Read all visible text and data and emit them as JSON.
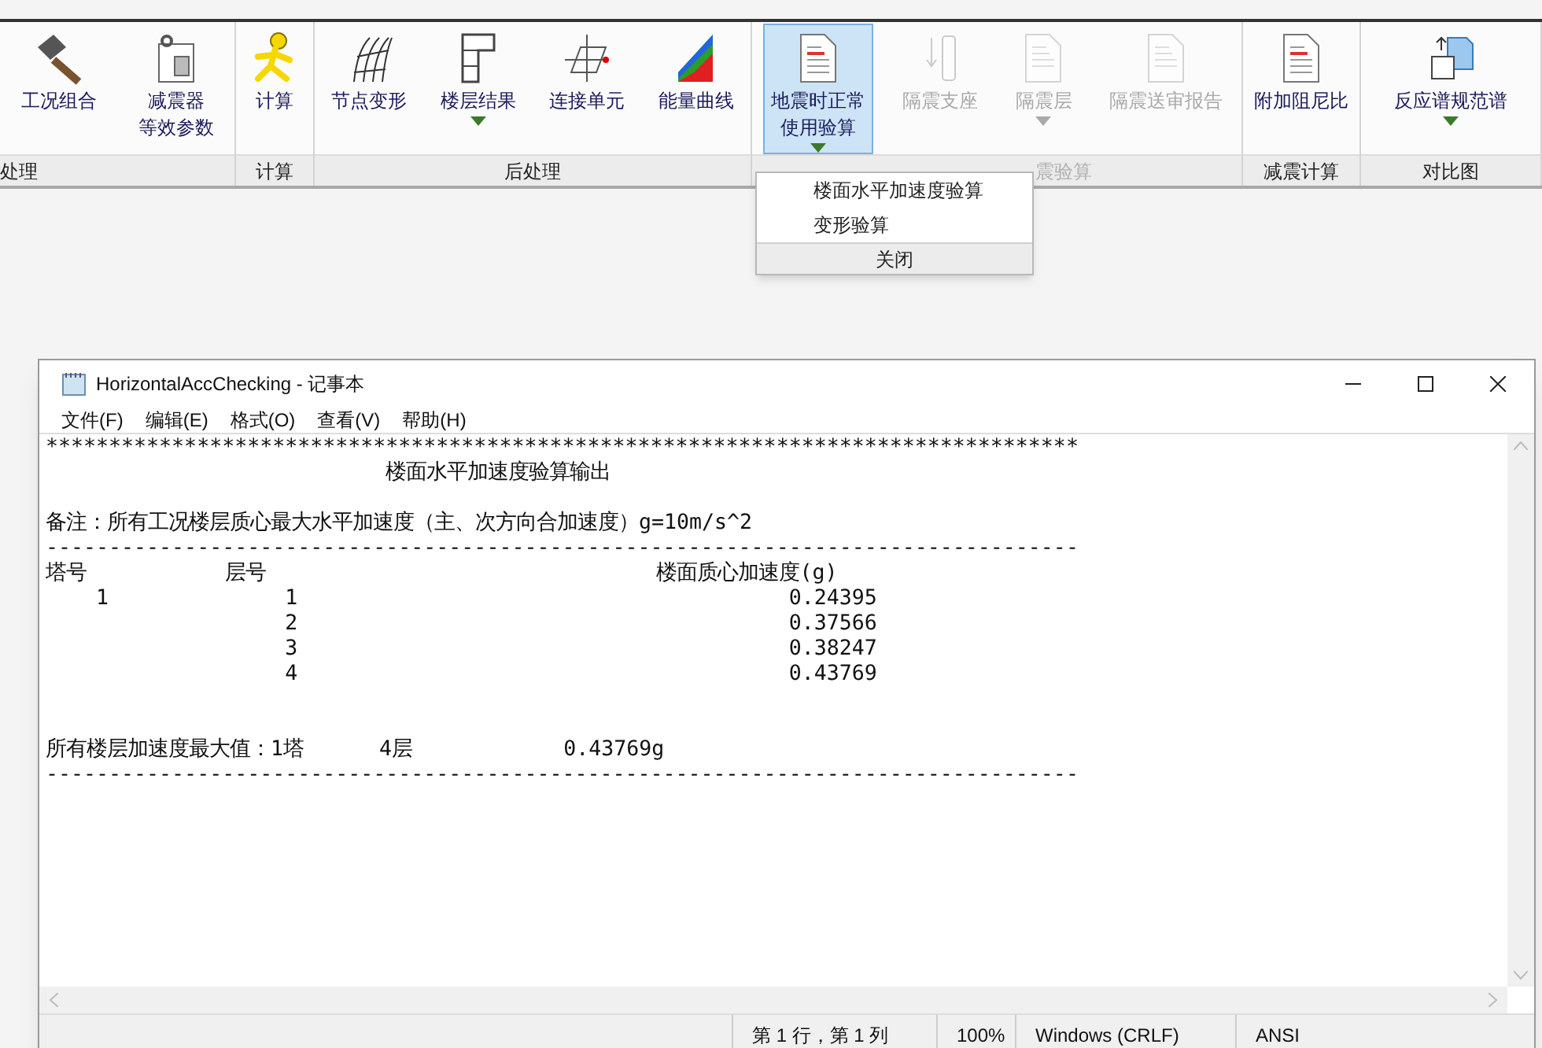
{
  "ribbon": {
    "groups": [
      {
        "label": "处理",
        "buttons": [
          {
            "label": "工况组合",
            "disabled": false,
            "selected": false,
            "dropdown": false
          },
          {
            "label": [
              "减震器",
              "等效参数"
            ],
            "disabled": false,
            "selected": false,
            "dropdown": false
          }
        ]
      },
      {
        "label": "计算",
        "buttons": [
          {
            "label": "计算",
            "disabled": false,
            "selected": false,
            "dropdown": false
          }
        ]
      },
      {
        "label": "后处理",
        "buttons": [
          {
            "label": "节点变形",
            "disabled": false,
            "selected": false,
            "dropdown": false
          },
          {
            "label": "楼层结果",
            "disabled": false,
            "selected": false,
            "dropdown": true
          },
          {
            "label": "连接单元",
            "disabled": false,
            "selected": false,
            "dropdown": false
          },
          {
            "label": "能量曲线",
            "disabled": false,
            "selected": false,
            "dropdown": false
          }
        ]
      },
      {
        "label": "震验算",
        "disabled": true,
        "buttons": [
          {
            "label": [
              "地震时正常",
              "使用验算"
            ],
            "disabled": false,
            "selected": true,
            "dropdown": true
          },
          {
            "label": "隔震支座",
            "disabled": true,
            "selected": false,
            "dropdown": false
          },
          {
            "label": "隔震层",
            "disabled": true,
            "selected": false,
            "dropdown": true
          },
          {
            "label": "隔震送审报告",
            "disabled": true,
            "selected": false,
            "dropdown": false
          }
        ]
      },
      {
        "label": "减震计算",
        "buttons": [
          {
            "label": "附加阻尼比",
            "disabled": false,
            "selected": false,
            "dropdown": false
          }
        ]
      },
      {
        "label": "对比图",
        "buttons": [
          {
            "label": "反应谱规范谱",
            "disabled": false,
            "selected": false,
            "dropdown": true
          }
        ]
      }
    ]
  },
  "dropdown_menu": {
    "items": [
      "楼面水平加速度验算",
      "变形验算"
    ],
    "footer": "关闭"
  },
  "notepad": {
    "title": "HorizontalAccChecking - 记事本",
    "menu": [
      "文件(F)",
      "编辑(E)",
      "格式(O)",
      "查看(V)",
      "帮助(H)"
    ],
    "lines": [
      {
        "kind": "rule",
        "text": "**********************************************************************************"
      },
      {
        "kind": "heading",
        "text": "                           楼面水平加速度验算输出"
      },
      {
        "kind": "note",
        "text": "备注：所有工况楼层质心最大水平加速度（主、次方向合加速度）g=10m/s^2"
      },
      {
        "kind": "rule",
        "text": "----------------------------------------------------------------------------------"
      },
      {
        "kind": "row",
        "text": "塔号           层号                               楼面质心加速度(g)"
      },
      {
        "kind": "row",
        "text": "    1              1                                       0.24395"
      },
      {
        "kind": "row",
        "text": "                   2                                       0.37566"
      },
      {
        "kind": "row",
        "text": "                   3                                       0.38247"
      },
      {
        "kind": "row",
        "text": "                   4                                       0.43769"
      },
      {
        "kind": "summary",
        "text": "所有楼层加速度最大值：1塔      4层            0.43769g"
      },
      {
        "kind": "rule",
        "text": "----------------------------------------------------------------------------------"
      }
    ],
    "status": [
      "第 1 行，第 1 列",
      "100%",
      "Windows (CRLF)",
      "ANSI"
    ]
  }
}
